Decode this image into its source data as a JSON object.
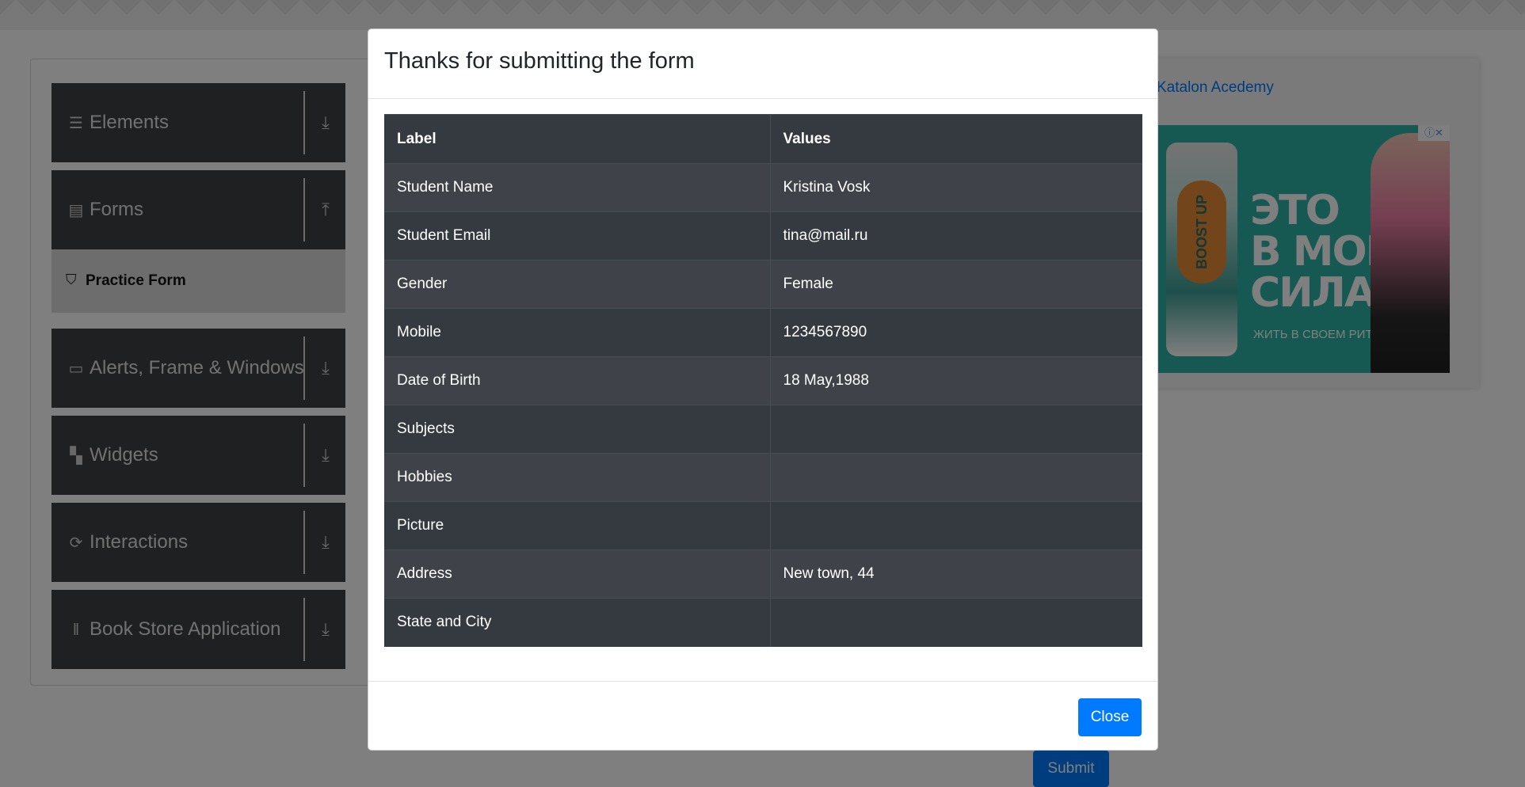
{
  "background": {
    "sidebar": {
      "groups": [
        {
          "label": "Elements",
          "icon": "hamburger-icon",
          "arrow": "download-icon"
        },
        {
          "label": "Forms",
          "icon": "document-icon",
          "arrow": "upload-icon"
        },
        {
          "label": "Alerts, Frame & Windows",
          "icon": "window-icon",
          "arrow": "download-icon"
        },
        {
          "label": "Widgets",
          "icon": "widgets-icon",
          "arrow": "download-icon"
        },
        {
          "label": "Interactions",
          "icon": "interactions-icon",
          "arrow": "download-icon"
        },
        {
          "label": "Book Store Application",
          "icon": "books-icon",
          "arrow": "download-icon"
        }
      ],
      "active_item": {
        "label": "Practice Form",
        "icon": "html5-icon"
      }
    },
    "ad": {
      "link_text": "Katalon Acedemy",
      "headline": "ЭТО\nВ МОИХ\nСИЛАХ",
      "tagline": "ЖИТЬ В СВОЕМ РИТМЕ",
      "brand": "BOOST UP"
    },
    "submit_label": "Submit"
  },
  "modal": {
    "title": "Thanks for submitting the form",
    "columns": [
      "Label",
      "Values"
    ],
    "rows": [
      {
        "label": "Student Name",
        "value": "Kristina Vosk"
      },
      {
        "label": "Student Email",
        "value": "tina@mail.ru"
      },
      {
        "label": "Gender",
        "value": "Female"
      },
      {
        "label": "Mobile",
        "value": "1234567890"
      },
      {
        "label": "Date of Birth",
        "value": "18 May,1988"
      },
      {
        "label": "Subjects",
        "value": ""
      },
      {
        "label": "Hobbies",
        "value": ""
      },
      {
        "label": "Picture",
        "value": ""
      },
      {
        "label": "Address",
        "value": "New town, 44"
      },
      {
        "label": "State and City",
        "value": ""
      }
    ],
    "close_label": "Close"
  }
}
